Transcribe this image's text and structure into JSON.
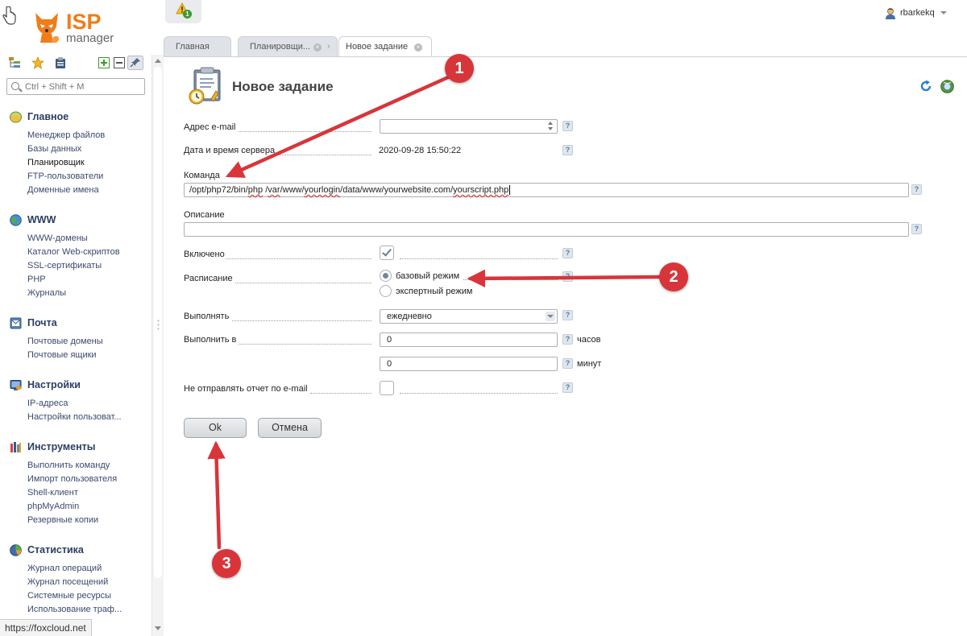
{
  "app": {
    "logo_isp": "ISP",
    "logo_manager": "manager",
    "notification_count": "1",
    "user_name": "rbarkekq"
  },
  "tabs": [
    {
      "label": "Главная"
    },
    {
      "label": "Планировщи..."
    },
    {
      "label": "Новое задание"
    }
  ],
  "sidebar": {
    "search_placeholder": "Ctrl + Shift + M",
    "groups": [
      {
        "title": "Главное",
        "items": [
          "Менеджер файлов",
          "Базы данных",
          "Планировщик",
          "FTP-пользователи",
          "Доменные имена"
        ]
      },
      {
        "title": "WWW",
        "items": [
          "WWW-домены",
          "Каталог Web-скриптов",
          "SSL-сертификаты",
          "PHP",
          "Журналы"
        ]
      },
      {
        "title": "Почта",
        "items": [
          "Почтовые домены",
          "Почтовые ящики"
        ]
      },
      {
        "title": "Настройки",
        "items": [
          "IP-адреса",
          "Настройки пользоват..."
        ]
      },
      {
        "title": "Инструменты",
        "items": [
          "Выполнить команду",
          "Импорт пользователя",
          "Shell-клиент",
          "phpMyAdmin",
          "Резервные копии"
        ]
      },
      {
        "title": "Статистика",
        "items": [
          "Журнал операций",
          "Журнал посещений",
          "Системные ресурсы",
          "Использование траф..."
        ]
      }
    ]
  },
  "status_bar": {
    "url": "https://foxcloud.net"
  },
  "form": {
    "title": "Новое задание",
    "email_label": "Адрес e-mail",
    "email_value": "",
    "server_time_label": "Дата и время сервера",
    "server_time_value": "2020-09-28 15:50:22",
    "command_label": "Команда",
    "command_parts": [
      "/opt/php72/bin/",
      "php",
      " /",
      "var",
      "/www/",
      "yourlogin",
      "/data/www/yourwebsite.com/",
      "yourscript.php"
    ],
    "description_label": "Описание",
    "description_value": "",
    "enabled_label": "Включено",
    "schedule_label": "Расписание",
    "schedule_basic": "базовый режим",
    "schedule_expert": "экспертный режим",
    "run_label": "Выполнять",
    "run_value": "ежедневно",
    "run_at_label": "Выполнить в",
    "hours_value": "0",
    "hours_unit": "часов",
    "minutes_value": "0",
    "minutes_unit": "минут",
    "no_report_label": "Не отправлять отчет по e-mail",
    "help_mark": "?",
    "ok_label": "Ok",
    "cancel_label": "Отмена"
  },
  "annotations": [
    "1",
    "2",
    "3"
  ],
  "colors": {
    "accent": "#f07d18",
    "marker": "#d8353a",
    "nav_text": "#2b3e63"
  }
}
